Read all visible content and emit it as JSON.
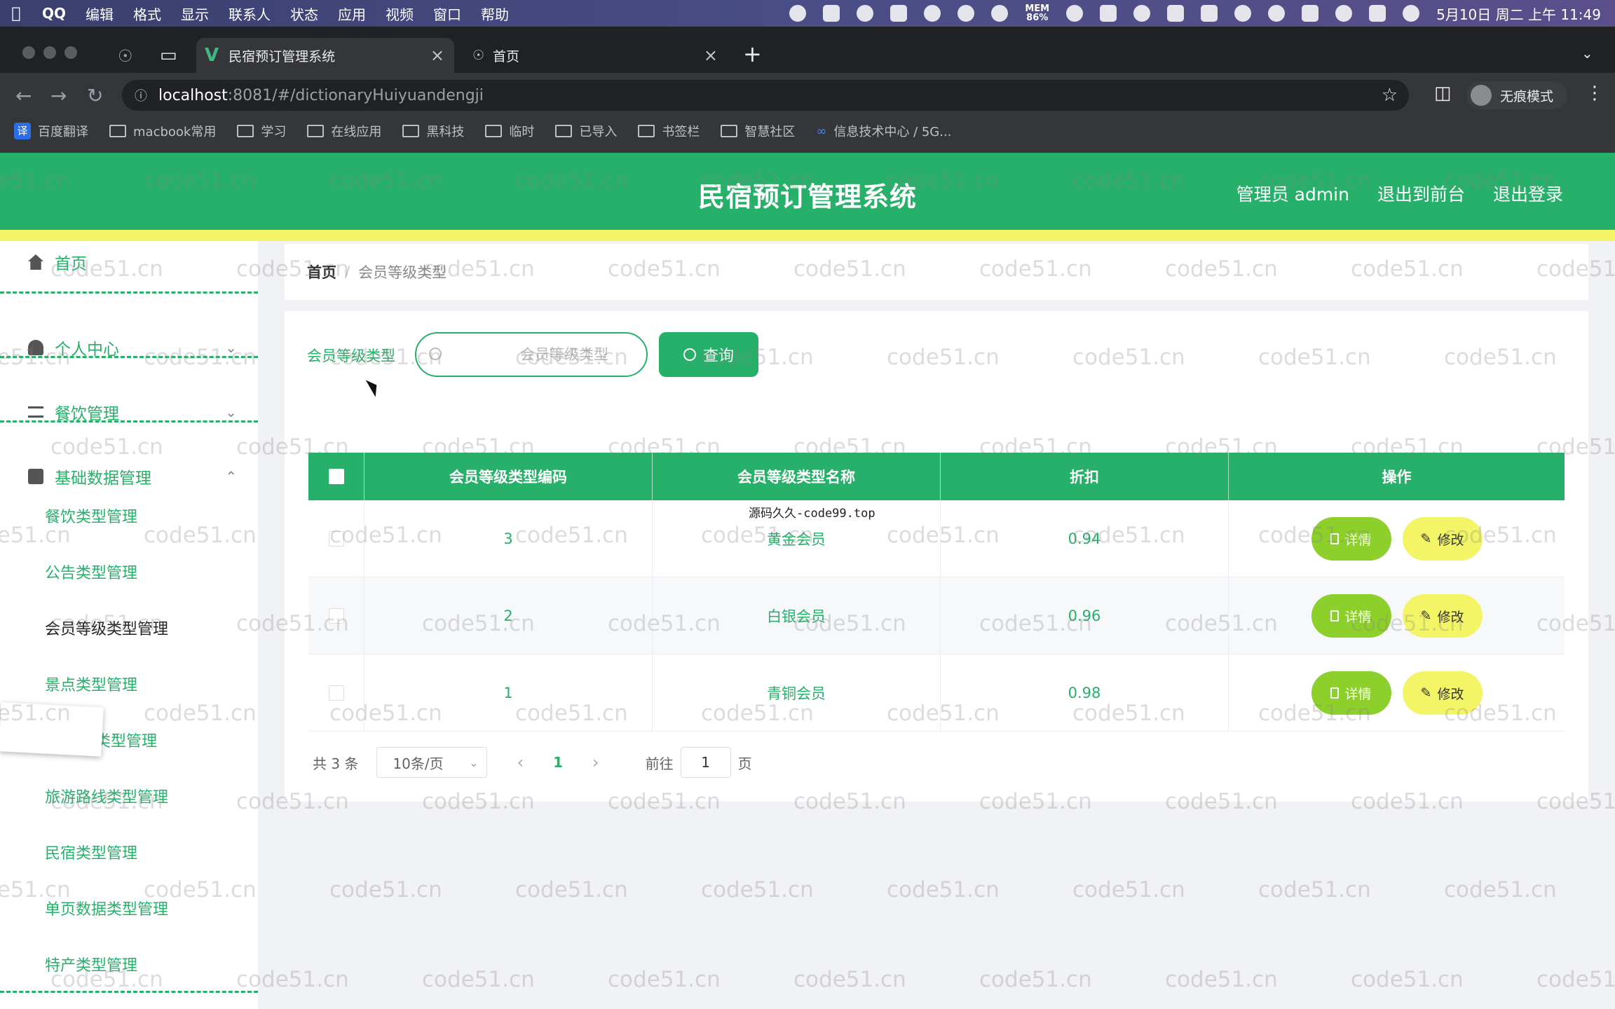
{
  "menubar": {
    "items": [
      "QQ",
      "编辑",
      "格式",
      "显示",
      "联系人",
      "状态",
      "应用",
      "视频",
      "窗口",
      "帮助"
    ],
    "mem_label": "MEM",
    "mem_value": "86%",
    "datetime": "5月10日 周二 上午 11:49"
  },
  "browser": {
    "tabs": [
      {
        "label": "民宿预订管理系统"
      },
      {
        "label": "首页"
      }
    ],
    "url_host": "localhost",
    "url_path": ":8081/#/dictionaryHuiyuandengji",
    "incognito_label": "无痕模式",
    "bookmarks": [
      "百度翻译",
      "macbook常用",
      "学习",
      "在线应用",
      "黑科技",
      "临时",
      "已导入",
      "书签栏",
      "智慧社区",
      "信息技术中心 / 5G..."
    ],
    "baidu_glyph": "译"
  },
  "header": {
    "title": "民宿预订管理系统",
    "admin": "管理员 admin",
    "to_front": "退出到前台",
    "logout": "退出登录"
  },
  "sidebar": {
    "home": "首页",
    "personal": "个人中心",
    "catering": "餐饮管理",
    "basic": "基础数据管理",
    "subs": [
      "餐饮类型管理",
      "公告类型管理",
      "会员等级类型管理",
      "景点类型管理",
      "类型管理",
      "旅游路线类型管理",
      "民宿类型管理",
      "单页数据类型管理",
      "特产类型管理"
    ]
  },
  "breadcrumb": {
    "home": "首页",
    "sep": "/",
    "current": "会员等级类型"
  },
  "search": {
    "label": "会员等级类型",
    "placeholder": "会员等级类型",
    "button": "查询"
  },
  "table": {
    "headers": [
      "会员等级类型编码",
      "会员等级类型名称",
      "折扣",
      "操作"
    ],
    "rows": [
      {
        "code": "3",
        "name": "黄金会员",
        "discount": "0.94"
      },
      {
        "code": "2",
        "name": "白银会员",
        "discount": "0.96"
      },
      {
        "code": "1",
        "name": "青铜会员",
        "discount": "0.98"
      }
    ],
    "detail_label": "详情",
    "edit_label": "修改"
  },
  "overlay_text": "源码久久-code99.top",
  "pager": {
    "total": "共 3 条",
    "size": "10条/页",
    "current": "1",
    "goto": "前往",
    "goto_value": "1",
    "page": "页"
  },
  "watermark": "code51.cn",
  "colors": {
    "primary": "#27b06a",
    "accent_yellow": "#f3f566",
    "detail_green": "#8dcf2b"
  }
}
